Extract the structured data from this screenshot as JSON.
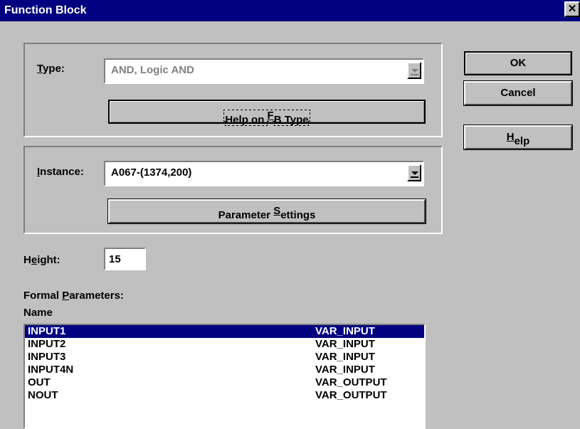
{
  "window": {
    "title": "Function Block",
    "close_glyph": "✕"
  },
  "type_group": {
    "label_first": "T",
    "label_rest": "ype:",
    "value": "AND, Logic AND",
    "help_button_pre": "Help on ",
    "help_button_ul": "F",
    "help_button_post": "B Type"
  },
  "instance_group": {
    "label_first": "I",
    "label_rest": "nstance:",
    "value": "A067-(1374,200)",
    "param_button_pre": "Parameter ",
    "param_button_ul": "S",
    "param_button_post": "ettings"
  },
  "height": {
    "label_pre": "H",
    "label_ul": "e",
    "label_post": "ight:",
    "value": "15"
  },
  "formal": {
    "label_pre": "Formal ",
    "label_ul": "P",
    "label_post": "arameters:",
    "column_name": "Name",
    "rows": [
      {
        "name": "INPUT1",
        "kind": "VAR_INPUT"
      },
      {
        "name": "INPUT2",
        "kind": "VAR_INPUT"
      },
      {
        "name": "INPUT3",
        "kind": "VAR_INPUT"
      },
      {
        "name": "INPUT4N",
        "kind": "VAR_INPUT"
      },
      {
        "name": "OUT",
        "kind": "VAR_OUTPUT"
      },
      {
        "name": "NOUT",
        "kind": "VAR_OUTPUT"
      }
    ]
  },
  "buttons": {
    "ok": "OK",
    "cancel": "Cancel",
    "help_ul": "H",
    "help_rest": "elp"
  },
  "colors": {
    "titlebar": "#000080",
    "face": "#c0c0c0",
    "selection": "#000080"
  },
  "icons": [
    "close-icon",
    "dropdown-arrow-icon"
  ]
}
